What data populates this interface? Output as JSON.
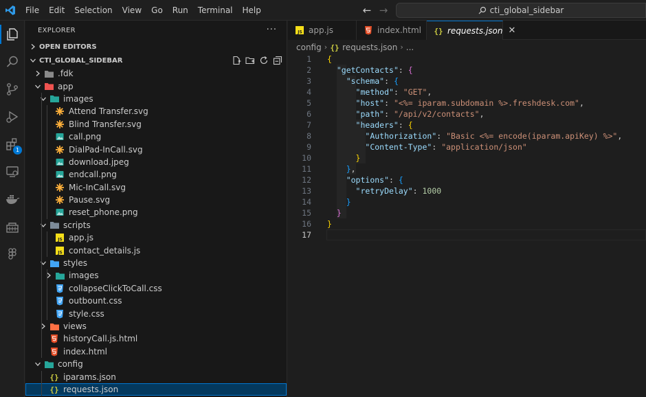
{
  "menu": [
    "File",
    "Edit",
    "Selection",
    "View",
    "Go",
    "Run",
    "Terminal",
    "Help"
  ],
  "search": {
    "text": "cti_global_sidebar"
  },
  "activity": {
    "extensions_badge": "1"
  },
  "sidebar": {
    "title": "EXPLORER",
    "more": "···",
    "open_editors": "OPEN EDITORS",
    "workspace": "CTI_GLOBAL_SIDEBAR",
    "tree": [
      {
        "label": ".fdk",
        "depth": 0,
        "kind": "folder",
        "open": false,
        "icon": "folder"
      },
      {
        "label": "app",
        "depth": 0,
        "kind": "folder",
        "open": true,
        "icon": "folder-app"
      },
      {
        "label": "images",
        "depth": 1,
        "kind": "folder",
        "open": true,
        "icon": "folder-images"
      },
      {
        "label": "Attend Transfer.svg",
        "depth": 2,
        "kind": "file",
        "icon": "svg"
      },
      {
        "label": "Blind Transfer.svg",
        "depth": 2,
        "kind": "file",
        "icon": "svg"
      },
      {
        "label": "call.png",
        "depth": 2,
        "kind": "file",
        "icon": "image"
      },
      {
        "label": "DialPad-InCall.svg",
        "depth": 2,
        "kind": "file",
        "icon": "svg"
      },
      {
        "label": "download.jpeg",
        "depth": 2,
        "kind": "file",
        "icon": "image"
      },
      {
        "label": "endcall.png",
        "depth": 2,
        "kind": "file",
        "icon": "image"
      },
      {
        "label": "Mic-InCall.svg",
        "depth": 2,
        "kind": "file",
        "icon": "svg"
      },
      {
        "label": "Pause.svg",
        "depth": 2,
        "kind": "file",
        "icon": "svg"
      },
      {
        "label": "reset_phone.png",
        "depth": 2,
        "kind": "file",
        "icon": "image"
      },
      {
        "label": "scripts",
        "depth": 1,
        "kind": "folder",
        "open": true,
        "icon": "folder-scripts"
      },
      {
        "label": "app.js",
        "depth": 2,
        "kind": "file",
        "icon": "js"
      },
      {
        "label": "contact_details.js",
        "depth": 2,
        "kind": "file",
        "icon": "js"
      },
      {
        "label": "styles",
        "depth": 1,
        "kind": "folder",
        "open": true,
        "icon": "folder-styles"
      },
      {
        "label": "images",
        "depth": 2,
        "kind": "folder",
        "open": false,
        "icon": "folder-images"
      },
      {
        "label": "collapseClickToCall.css",
        "depth": 2,
        "kind": "file",
        "icon": "css"
      },
      {
        "label": "outbount.css",
        "depth": 2,
        "kind": "file",
        "icon": "css"
      },
      {
        "label": "style.css",
        "depth": 2,
        "kind": "file",
        "icon": "css"
      },
      {
        "label": "views",
        "depth": 1,
        "kind": "folder",
        "open": false,
        "icon": "folder-views"
      },
      {
        "label": "historyCall.js.html",
        "depth": 1,
        "kind": "file",
        "icon": "html"
      },
      {
        "label": "index.html",
        "depth": 1,
        "kind": "file",
        "icon": "html"
      },
      {
        "label": "config",
        "depth": 0,
        "kind": "folder",
        "open": true,
        "icon": "folder-config"
      },
      {
        "label": "iparams.json",
        "depth": 1,
        "kind": "file",
        "icon": "json"
      },
      {
        "label": "requests.json",
        "depth": 1,
        "kind": "file",
        "icon": "json",
        "selected": true
      }
    ]
  },
  "tabs": [
    {
      "label": "app.js",
      "icon": "js",
      "active": false
    },
    {
      "label": "index.html",
      "icon": "html",
      "active": false
    },
    {
      "label": "requests.json",
      "icon": "json",
      "active": true
    }
  ],
  "breadcrumb": [
    "config",
    "requests.json",
    "..."
  ],
  "editor": {
    "current_line": 17,
    "lines": [
      [
        [
          "{",
          "b1"
        ]
      ],
      [
        [
          "  ",
          "p"
        ],
        [
          "\"getContacts\"",
          "k"
        ],
        [
          ": ",
          "p"
        ],
        [
          "{",
          "b2"
        ]
      ],
      [
        [
          "    ",
          "p"
        ],
        [
          "\"schema\"",
          "k"
        ],
        [
          ": ",
          "p"
        ],
        [
          "{",
          "b3"
        ]
      ],
      [
        [
          "      ",
          "p"
        ],
        [
          "\"method\"",
          "k"
        ],
        [
          ": ",
          "p"
        ],
        [
          "\"GET\"",
          "s"
        ],
        [
          ",",
          "p"
        ]
      ],
      [
        [
          "      ",
          "p"
        ],
        [
          "\"host\"",
          "k"
        ],
        [
          ": ",
          "p"
        ],
        [
          "\"<%= iparam.subdomain %>.freshdesk.com\"",
          "s"
        ],
        [
          ",",
          "p"
        ]
      ],
      [
        [
          "      ",
          "p"
        ],
        [
          "\"path\"",
          "k"
        ],
        [
          ": ",
          "p"
        ],
        [
          "\"/api/v2/contacts\"",
          "s"
        ],
        [
          ",",
          "p"
        ]
      ],
      [
        [
          "      ",
          "p"
        ],
        [
          "\"headers\"",
          "k"
        ],
        [
          ": ",
          "p"
        ],
        [
          "{",
          "b1"
        ]
      ],
      [
        [
          "        ",
          "p"
        ],
        [
          "\"Authorization\"",
          "k"
        ],
        [
          ": ",
          "p"
        ],
        [
          "\"Basic <%= encode(iparam.apiKey) %>\"",
          "s"
        ],
        [
          ",",
          "p"
        ]
      ],
      [
        [
          "        ",
          "p"
        ],
        [
          "\"Content-Type\"",
          "k"
        ],
        [
          ": ",
          "p"
        ],
        [
          "\"application/json\"",
          "s"
        ]
      ],
      [
        [
          "      ",
          "p"
        ],
        [
          "}",
          "b1"
        ]
      ],
      [
        [
          "    ",
          "p"
        ],
        [
          "}",
          "b3"
        ],
        [
          ",",
          "p"
        ]
      ],
      [
        [
          "    ",
          "p"
        ],
        [
          "\"options\"",
          "k"
        ],
        [
          ": ",
          "p"
        ],
        [
          "{",
          "b3"
        ]
      ],
      [
        [
          "      ",
          "p"
        ],
        [
          "\"retryDelay\"",
          "k"
        ],
        [
          ": ",
          "p"
        ],
        [
          "1000",
          "n"
        ]
      ],
      [
        [
          "    ",
          "p"
        ],
        [
          "}",
          "b3"
        ]
      ],
      [
        [
          "  ",
          "p"
        ],
        [
          "}",
          "b2"
        ]
      ],
      [
        [
          "}",
          "b1"
        ]
      ],
      []
    ]
  }
}
